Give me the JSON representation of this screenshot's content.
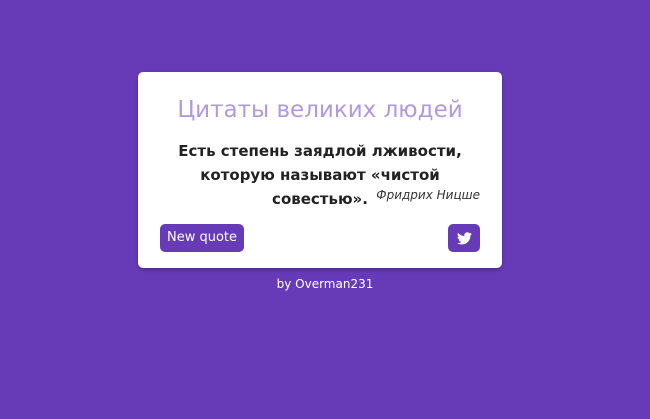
{
  "page": {
    "background_color": "#673ab7"
  },
  "card": {
    "title": "Цитаты великих людей",
    "title_color": "#b299dd",
    "quote_text": "Есть степень заядлой лживости, которую называют «чистой совестью».",
    "quote_author": "Фридрих Ницше",
    "new_quote_label": "New quote",
    "tweet_icon": "twitter-icon",
    "accent_color": "#673ab7"
  },
  "footer": {
    "text": "by Overman231"
  }
}
